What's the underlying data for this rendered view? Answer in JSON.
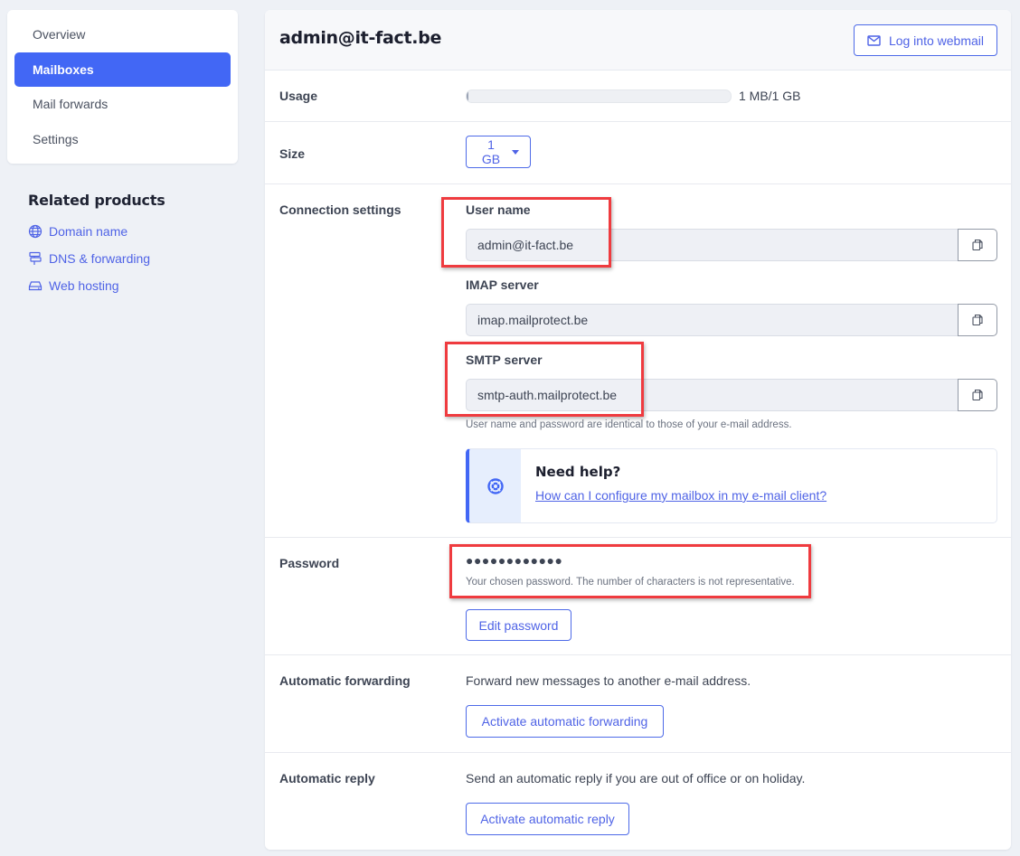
{
  "sidebar": {
    "items": [
      {
        "label": "Overview",
        "active": false
      },
      {
        "label": "Mailboxes",
        "active": true
      },
      {
        "label": "Mail forwards",
        "active": false
      },
      {
        "label": "Settings",
        "active": false
      }
    ]
  },
  "related": {
    "title": "Related products",
    "links": [
      {
        "label": "Domain name",
        "icon": "globe-icon"
      },
      {
        "label": "DNS & forwarding",
        "icon": "signpost-icon"
      },
      {
        "label": "Web hosting",
        "icon": "server-icon"
      }
    ]
  },
  "main": {
    "title": "admin@it-fact.be",
    "webmail_button": "Log into webmail",
    "usage": {
      "label": "Usage",
      "value_text": "1 MB/1 GB",
      "fraction": 0.001
    },
    "size": {
      "label": "Size",
      "selected": "1 GB"
    },
    "connection": {
      "label": "Connection settings",
      "fields": [
        {
          "label": "User name",
          "value": "admin@it-fact.be"
        },
        {
          "label": "IMAP server",
          "value": "imap.mailprotect.be"
        },
        {
          "label": "SMTP server",
          "value": "smtp-auth.mailprotect.be"
        }
      ],
      "hint": "User name and password are identical to those of your e-mail address.",
      "help": {
        "title": "Need help?",
        "link": "How can I configure my mailbox in my e-mail client?"
      }
    },
    "password": {
      "label": "Password",
      "masked": "●●●●●●●●●●●●",
      "hint": "Your chosen password. The number of characters is not representative.",
      "edit_button": "Edit password"
    },
    "forwarding": {
      "label": "Automatic forwarding",
      "description": "Forward new messages to another e-mail address.",
      "button": "Activate automatic forwarding"
    },
    "reply": {
      "label": "Automatic reply",
      "description": "Send an automatic reply if you are out of office or on holiday.",
      "button": "Activate automatic reply"
    }
  },
  "colors": {
    "accent": "#4267f5",
    "link": "#4f63e6",
    "annotation": "#ef3b3f",
    "background": "#eef1f6"
  }
}
